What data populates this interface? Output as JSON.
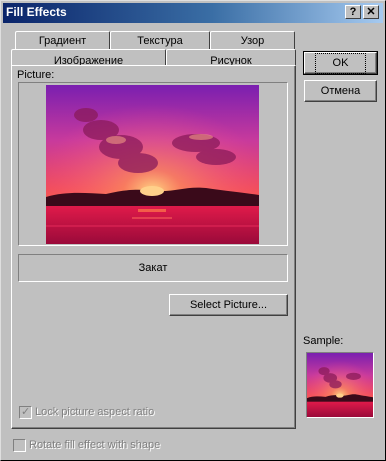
{
  "window": {
    "title": "Fill Effects",
    "help_glyph": "?",
    "close_glyph": "✕"
  },
  "tabs": {
    "row1": [
      "Градиент",
      "Текстура",
      "Узор"
    ],
    "row2": [
      "Изображение",
      "Рисунок"
    ]
  },
  "panel": {
    "picture_label": "Picture:",
    "picture_name": "Закат",
    "select_button": "Select Picture...",
    "lock_aspect_label": "Lock picture aspect ratio",
    "lock_aspect_checked": true
  },
  "side": {
    "ok_label": "OK",
    "cancel_label": "Отмена",
    "sample_label": "Sample:"
  },
  "footer": {
    "rotate_label": "Rotate fill effect with shape",
    "rotate_checked": false
  }
}
